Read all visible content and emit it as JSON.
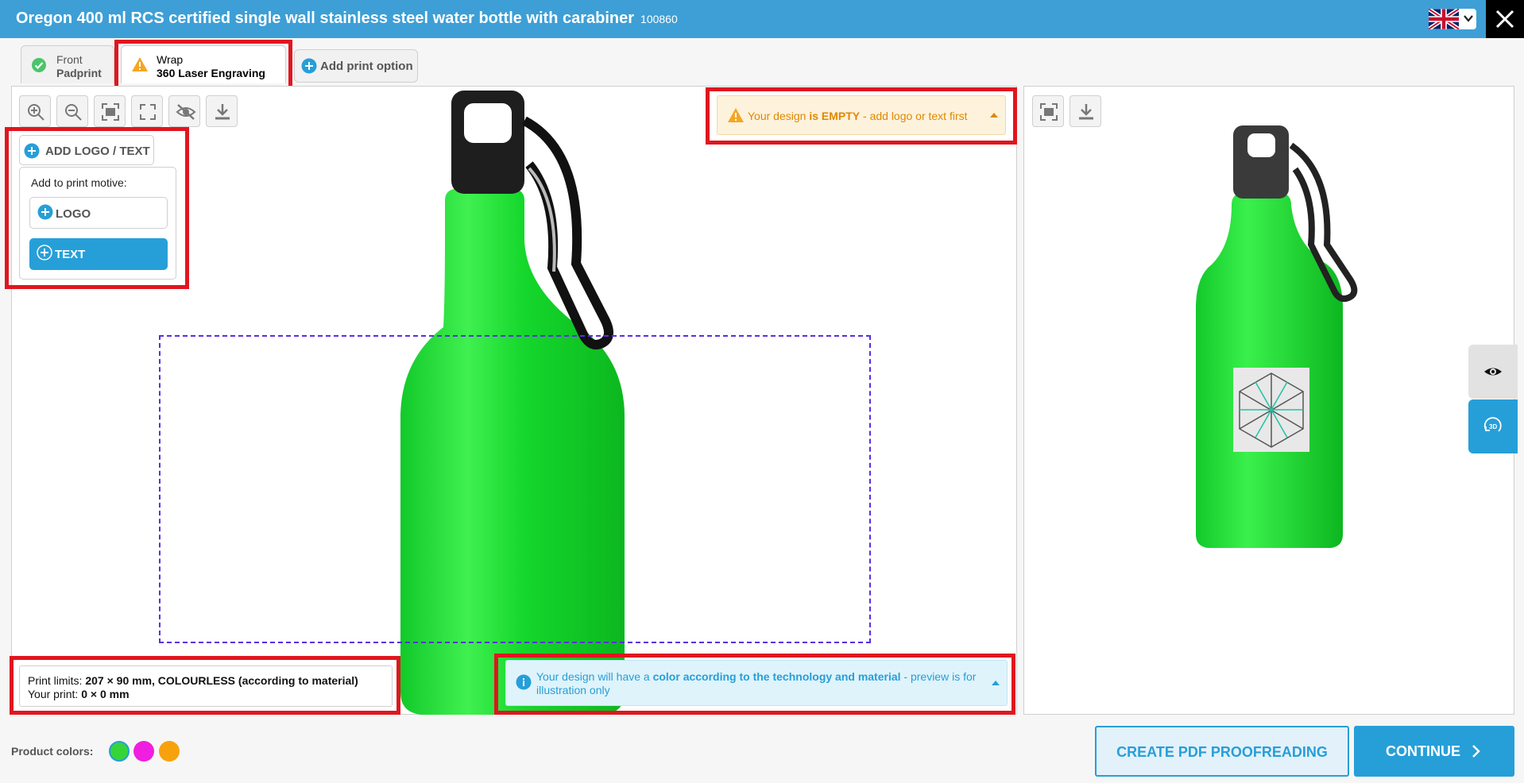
{
  "header": {
    "title": "Oregon 400 ml RCS certified single wall stainless steel water bottle with carabiner",
    "product_code": "100860",
    "language_flag": "uk-flag-icon",
    "color": "#3d9fd6"
  },
  "tabs": [
    {
      "line1": "Front",
      "line2": "Padprint",
      "status": "complete"
    },
    {
      "line1": "Wrap",
      "line2": "360 Laser Engraving",
      "status": "warning"
    }
  ],
  "add_print_option": {
    "label": "Add print option"
  },
  "toolbar": {
    "tools": [
      "zoom-in-icon",
      "zoom-out-icon",
      "fit-screen-icon",
      "fullscreen-icon",
      "hide-icon",
      "download-icon"
    ]
  },
  "add_panel": {
    "button_label": "ADD LOGO / TEXT",
    "motive_label": "Add to print motive:",
    "logo_label": "LOGO",
    "text_label": "TEXT"
  },
  "warning": {
    "prefix": "Your design ",
    "bold": "is EMPTY",
    "suffix": " - add logo or text first"
  },
  "print_limits": {
    "label": "Print limits: ",
    "value": "207 × 90 mm, COLOURLESS (according to material)",
    "your_label": "Your print: ",
    "your_value": "0 × 0 mm"
  },
  "info": {
    "prefix": "Your design will have a ",
    "bold": "color according to the technology and material",
    "suffix": " - preview is for illustration only"
  },
  "preview_tools": [
    "fit-screen-icon",
    "download-icon"
  ],
  "side_tabs": [
    "eye-icon",
    "3d-icon"
  ],
  "product_colors": {
    "label": "Product colors:",
    "colors": [
      "#35d53a",
      "#f01ee0",
      "#f7a20d"
    ],
    "selected": 0
  },
  "actions": {
    "pdf_label": "CREATE PDF PROOFREADING",
    "continue_label": "CONTINUE"
  }
}
